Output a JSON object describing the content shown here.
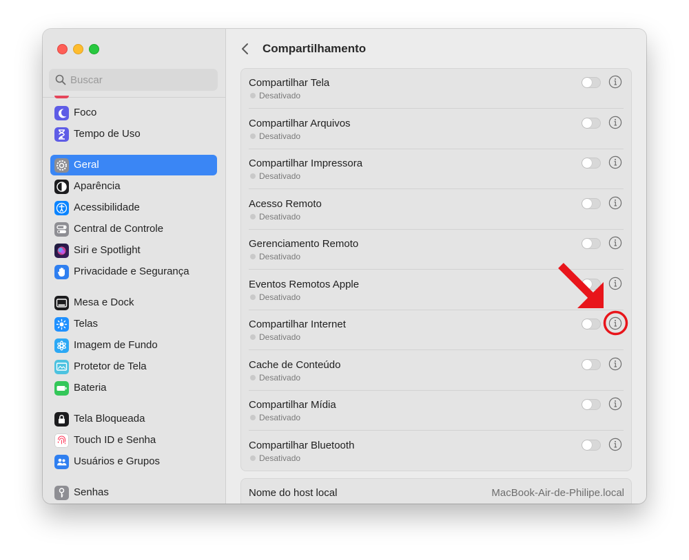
{
  "window": {
    "title": "Compartilhamento"
  },
  "search": {
    "placeholder": "Buscar"
  },
  "sidebar": {
    "items": [
      {
        "label": "Foco",
        "icon": "moon-icon",
        "color": "#5e5ce6"
      },
      {
        "label": "Tempo de Uso",
        "icon": "hourglass-icon",
        "color": "#5e5ce6"
      },
      {
        "label": "Geral",
        "icon": "gear-icon",
        "color": "#8e8e93",
        "selected": true
      },
      {
        "label": "Aparência",
        "icon": "appearance-icon",
        "color": "#1c1c1e"
      },
      {
        "label": "Acessibilidade",
        "icon": "accessibility-icon",
        "color": "#0a84ff"
      },
      {
        "label": "Central de Controle",
        "icon": "toggles-icon",
        "color": "#8e8e93"
      },
      {
        "label": "Siri e Spotlight",
        "icon": "siri-icon",
        "color": "#7b3fe4"
      },
      {
        "label": "Privacidade e Segurança",
        "icon": "hand-icon",
        "color": "#2f7ff0"
      },
      {
        "label": "Mesa e Dock",
        "icon": "dock-icon",
        "color": "#1c1c1e"
      },
      {
        "label": "Telas",
        "icon": "sun-icon",
        "color": "#1e90ff"
      },
      {
        "label": "Imagem de Fundo",
        "icon": "flower-icon",
        "color": "#2ba8f5"
      },
      {
        "label": "Protetor de Tela",
        "icon": "screensaver-icon",
        "color": "#4cc2e0"
      },
      {
        "label": "Bateria",
        "icon": "battery-icon",
        "color": "#34c759"
      },
      {
        "label": "Tela Bloqueada",
        "icon": "lock-icon",
        "color": "#1c1c1e"
      },
      {
        "label": "Touch ID e Senha",
        "icon": "fingerprint-icon",
        "color": "#ffffff"
      },
      {
        "label": "Usuários e Grupos",
        "icon": "users-icon",
        "color": "#2f7ff0"
      },
      {
        "label": "Senhas",
        "icon": "key-icon",
        "color": "#8e8e93"
      }
    ]
  },
  "sharing": {
    "items": [
      {
        "name": "Compartilhar Tela",
        "status": "Desativado",
        "enabled": false
      },
      {
        "name": "Compartilhar Arquivos",
        "status": "Desativado",
        "enabled": false
      },
      {
        "name": "Compartilhar Impressora",
        "status": "Desativado",
        "enabled": false
      },
      {
        "name": "Acesso Remoto",
        "status": "Desativado",
        "enabled": false
      },
      {
        "name": "Gerenciamento Remoto",
        "status": "Desativado",
        "enabled": false
      },
      {
        "name": "Eventos Remotos Apple",
        "status": "Desativado",
        "enabled": false
      },
      {
        "name": "Compartilhar Internet",
        "status": "Desativado",
        "enabled": false
      },
      {
        "name": "Cache de Conteúdo",
        "status": "Desativado",
        "enabled": false
      },
      {
        "name": "Compartilhar Mídia",
        "status": "Desativado",
        "enabled": false
      },
      {
        "name": "Compartilhar Bluetooth",
        "status": "Desativado",
        "enabled": false
      }
    ],
    "host": {
      "label": "Nome do host local",
      "value": "MacBook-Air-de-Philipe.local"
    }
  },
  "annotation": {
    "color": "#e8151b",
    "highlighted_item": "Compartilhar Internet"
  }
}
